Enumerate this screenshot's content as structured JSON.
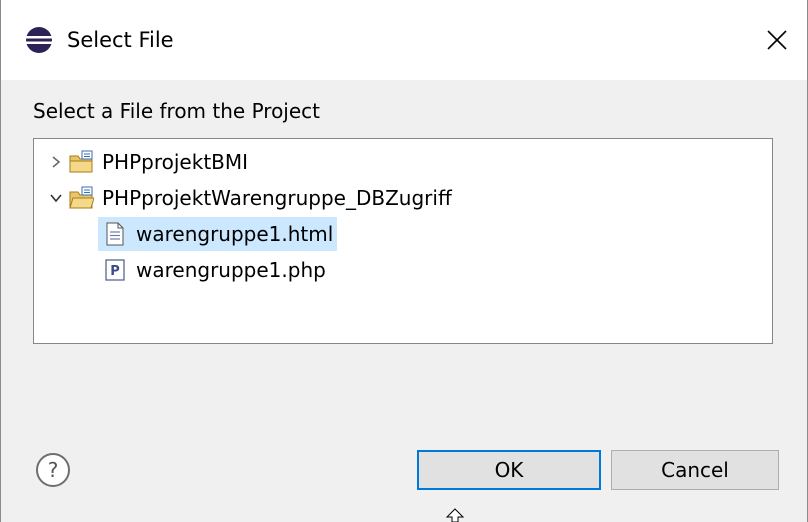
{
  "window": {
    "title": "Select File",
    "close_glyph": "✕",
    "app_icon": "eclipse-icon"
  },
  "prompt": "Select a File from the Project",
  "tree": {
    "items": [
      {
        "label": "PHPprojektBMI",
        "type": "project",
        "expanded": false,
        "icon": "project-folder-icon"
      },
      {
        "label": "PHPprojektWarengruppe_DBZugriff",
        "type": "project",
        "expanded": true,
        "icon": "project-folder-icon",
        "children": [
          {
            "label": "warengruppe1.html",
            "type": "html-file",
            "selected": true,
            "icon": "html-file-icon"
          },
          {
            "label": "warengruppe1.php",
            "type": "php-file",
            "selected": false,
            "icon": "php-file-icon"
          }
        ]
      }
    ]
  },
  "buttons": {
    "help_icon": "help-icon",
    "ok_label": "OK",
    "cancel_label": "Cancel"
  },
  "colors": {
    "selection": "#cce8ff",
    "default_button_border": "#0078d7",
    "dialog_bg": "#f0f0f0"
  }
}
